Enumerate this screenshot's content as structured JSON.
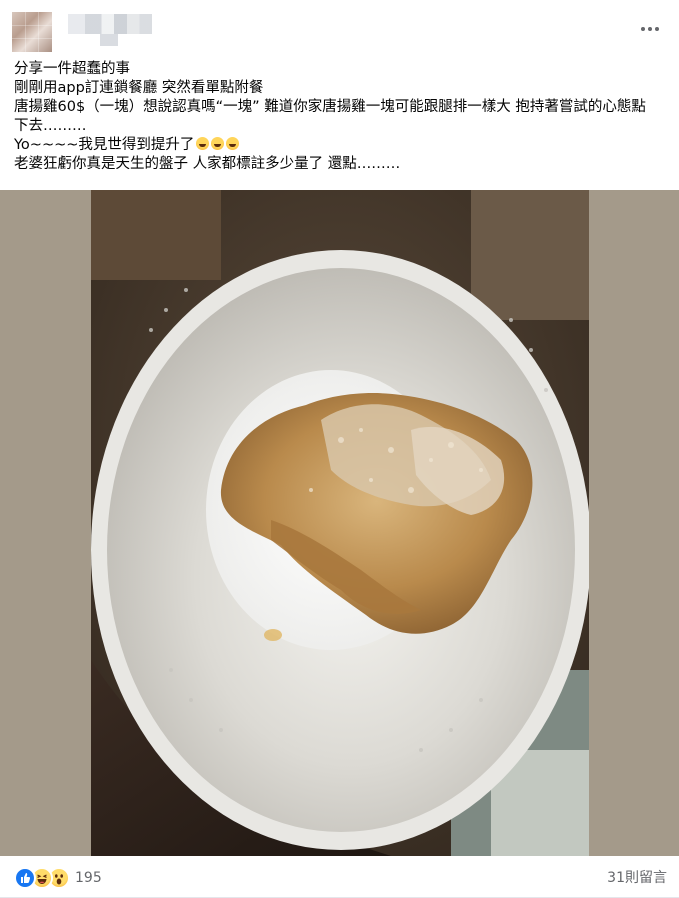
{
  "post": {
    "text_lines": [
      "分享一件超蠢的事",
      "剛剛用app訂連鎖餐廳 突然看單點附餐",
      "唐揚雞60$（一塊）想說認真嗎“一塊” 難道你家唐揚雞一塊可能跟腿排一樣大 抱持著嘗試的心態點",
      "下去………",
      "Yo~~~~我見世得到提升了",
      "老婆狂虧你真是天生的盤子 人家都標註多少量了 還點………"
    ]
  },
  "footer": {
    "reaction_count": "195",
    "comments_label": "31則留言"
  },
  "icons": {
    "more": "more-horizontal-icon",
    "like": "like-reaction-icon",
    "haha": "haha-reaction-icon",
    "wow": "wow-reaction-icon",
    "laugh_emoji": "laughing-emoji-icon"
  },
  "colors": {
    "accent": "#1877f2",
    "secondary_text": "#65676b",
    "photo_background": "#a49a8a"
  }
}
